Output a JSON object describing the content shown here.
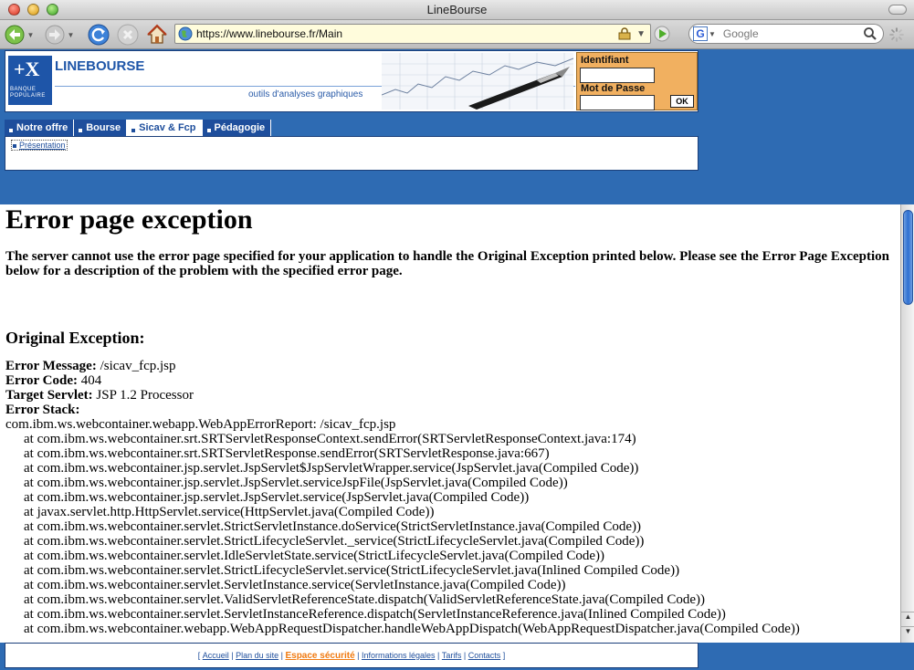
{
  "window": {
    "title": "LineBourse"
  },
  "toolbar": {
    "url": "https://www.linebourse.fr/Main",
    "search_placeholder": "Google",
    "search_engine_letter": "G",
    "icons": [
      "back-arrow-icon",
      "forward-arrow-icon",
      "reload-icon",
      "stop-icon",
      "home-icon",
      "lock-icon",
      "go-arrow-icon",
      "search-icon"
    ]
  },
  "site": {
    "logo_mark": "+X",
    "logo_sub": "BANQUE POPULAIRE",
    "brand": "LINEBOURSE",
    "tagline": "outils d'analyses graphiques",
    "login": {
      "id_label": "Identifiant",
      "pw_label": "Mot de Passe",
      "ok_label": "OK"
    },
    "nav": [
      "Notre offre",
      "Bourse",
      "Sicav & Fcp",
      "Pédagogie"
    ],
    "nav_active": "Sicav & Fcp",
    "subnav_item": "Présentation",
    "colors": {
      "page_bg": "#2e6bb3",
      "nav_bg": "#1e4e9c",
      "login_bg": "#f1b060",
      "secure_link": "#f07a10"
    }
  },
  "error": {
    "title": "Error page exception",
    "intro": "The server cannot use the error page specified for your application to handle the Original Exception printed below. Please see the Error Page Exception below for a description of the problem with the specified error page.",
    "orig_title": "Original Exception:",
    "message_label": "Error Message:",
    "message": "/sicav_fcp.jsp",
    "code_label": "Error Code:",
    "code": "404",
    "servlet_label": "Target Servlet:",
    "servlet": "JSP 1.2 Processor",
    "stack_label": "Error Stack:",
    "stack_head": "com.ibm.ws.webcontainer.webapp.WebAppErrorReport: /sicav_fcp.jsp",
    "stack": [
      "at com.ibm.ws.webcontainer.srt.SRTServletResponseContext.sendError(SRTServletResponseContext.java:174)",
      "at com.ibm.ws.webcontainer.srt.SRTServletResponse.sendError(SRTServletResponse.java:667)",
      "at com.ibm.ws.webcontainer.jsp.servlet.JspServlet$JspServletWrapper.service(JspServlet.java(Compiled Code))",
      "at com.ibm.ws.webcontainer.jsp.servlet.JspServlet.serviceJspFile(JspServlet.java(Compiled Code))",
      "at com.ibm.ws.webcontainer.jsp.servlet.JspServlet.service(JspServlet.java(Compiled Code))",
      "at javax.servlet.http.HttpServlet.service(HttpServlet.java(Compiled Code))",
      "at com.ibm.ws.webcontainer.servlet.StrictServletInstance.doService(StrictServletInstance.java(Compiled Code))",
      "at com.ibm.ws.webcontainer.servlet.StrictLifecycleServlet._service(StrictLifecycleServlet.java(Compiled Code))",
      "at com.ibm.ws.webcontainer.servlet.IdleServletState.service(StrictLifecycleServlet.java(Compiled Code))",
      "at com.ibm.ws.webcontainer.servlet.StrictLifecycleServlet.service(StrictLifecycleServlet.java(Inlined Compiled Code))",
      "at com.ibm.ws.webcontainer.servlet.ServletInstance.service(ServletInstance.java(Compiled Code))",
      "at com.ibm.ws.webcontainer.servlet.ValidServletReferenceState.dispatch(ValidServletReferenceState.java(Compiled Code))",
      "at com.ibm.ws.webcontainer.servlet.ServletInstanceReference.dispatch(ServletInstanceReference.java(Inlined Compiled Code))",
      "at com.ibm.ws.webcontainer.webapp.WebAppRequestDispatcher.handleWebAppDispatch(WebAppRequestDispatcher.java(Compiled Code))"
    ]
  },
  "footer": {
    "open": "[ ",
    "close": " ]",
    "sep": " | ",
    "links": [
      "Accueil",
      "Plan du site",
      "Espace sécurité",
      "Informations légales",
      "Tarifs",
      "Contacts"
    ]
  }
}
